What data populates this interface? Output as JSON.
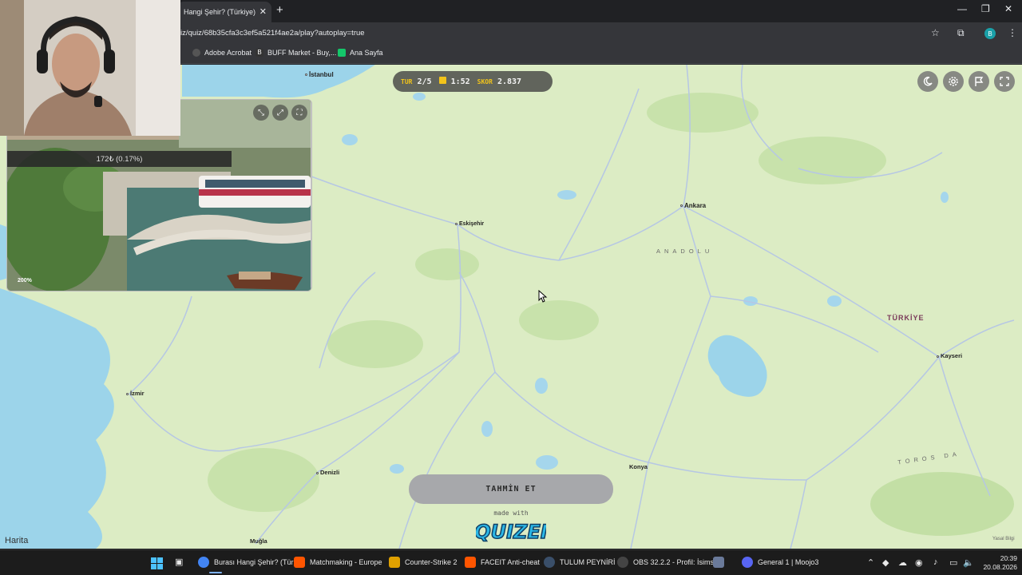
{
  "browser": {
    "tab_title": "Hangi Şehir? (Türkiye) - Q",
    "url": "iz/quiz/68b35cfa3c3ef5a521f4ae2a/play?autoplay=true",
    "profile_initial": "B",
    "bookmarks": [
      {
        "label": "Adobe Acrobat",
        "icon": "adobe-icon"
      },
      {
        "label": "BUFF Market - Buy,...",
        "icon": "buff-icon"
      },
      {
        "label": "Ana Sayfa",
        "icon": "ana-sayfa-icon"
      }
    ]
  },
  "hud": {
    "round_label": "TUR",
    "round_value": "2/5",
    "time_value": "1:52",
    "score_label": "SKOR",
    "score_value": "2.837"
  },
  "image_panel": {
    "progress_text": "172₺ (0.17%)",
    "zoom_text": "200%"
  },
  "map": {
    "cities": [
      {
        "name": "İstanbul"
      },
      {
        "name": "Ankara"
      },
      {
        "name": "Eskişehir"
      },
      {
        "name": "İzmir"
      },
      {
        "name": "Kayseri"
      },
      {
        "name": "Denizli"
      },
      {
        "name": "Konya"
      },
      {
        "name": "Muğla"
      }
    ],
    "region_anadolu": "ANADOLU",
    "region_toros": "TOROS DA",
    "country": "TÜRKİYE",
    "attribution_left": "Harita",
    "attribution_right": "Yasal Bilgi"
  },
  "guess_button": "TAHMİN ET",
  "made_with": "made with",
  "logo_text": "QUIZEI",
  "taskbar": {
    "items": [
      {
        "label": "Burası Hangi Şehir? (Tür",
        "color": "#4285f4"
      },
      {
        "label": "Matchmaking - Europe",
        "color": "#ff5500"
      },
      {
        "label": "Counter-Strike 2",
        "color": "#e0a100"
      },
      {
        "label": "FACEIT Anti-cheat",
        "color": "#ff5500"
      },
      {
        "label": "TULUM PEYNİRİ",
        "color": "#1b2838"
      },
      {
        "label": "OBS 32.2.2 - Profil: İsims",
        "color": "#444"
      },
      {
        "label": "General 1 | Moojo3",
        "color": "#5865f2"
      }
    ],
    "time": "20:39",
    "date": "20.08.2026"
  },
  "colors": {
    "accent": "#f2c41a",
    "map_land": "#dcecc4",
    "water": "#9cd4ea"
  }
}
